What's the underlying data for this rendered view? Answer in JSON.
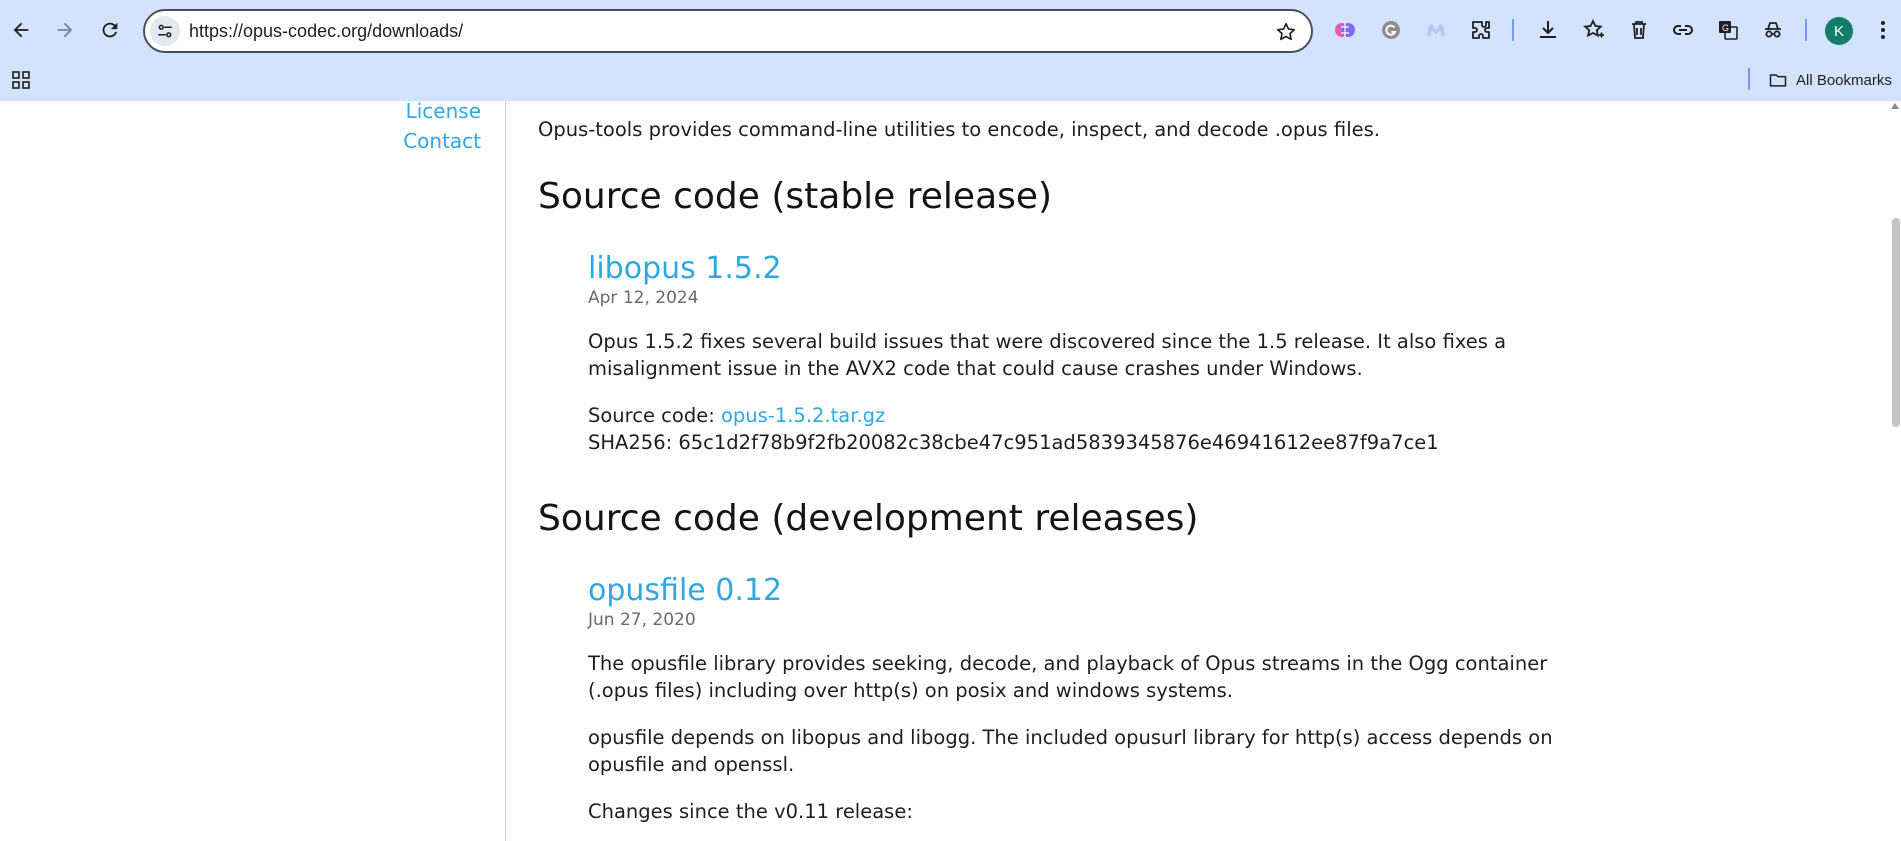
{
  "browser": {
    "url": "https://opus-codec.org/downloads/",
    "avatar_letter": "K",
    "all_bookmarks_label": "All Bookmarks",
    "icons": [
      "back-arrow-icon",
      "forward-arrow-icon",
      "reload-icon",
      "site-info-icon",
      "star-icon",
      "ai-brain-extension-icon",
      "grammarly-icon",
      "malwarebytes-icon",
      "puzzle-extensions-icon",
      "download-icon",
      "reading-list-icon",
      "trash-icon",
      "link-icon",
      "translate-icon",
      "incognito-spy-icon",
      "kebab-menu-icon",
      "apps-grid-icon",
      "folder-icon"
    ]
  },
  "sidebar": {
    "links": [
      "License",
      "Contact"
    ]
  },
  "main": {
    "intro": "Opus-tools provides command-line utilities to encode, inspect, and decode .opus files.",
    "stable_heading": "Source code (stable release)",
    "stable": {
      "title": "libopus 1.5.2",
      "date": "Apr 12, 2024",
      "description": "Opus 1.5.2 fixes several build issues that were discovered since the 1.5 release. It also fixes a misalignment issue in the AVX2 code that could cause crashes under Windows.",
      "source_label": "Source code: ",
      "source_link": "opus-1.5.2.tar.gz",
      "sha_line": "SHA256: 65c1d2f78b9f2fb20082c38cbe47c951ad5839345876e46941612ee87f9a7ce1"
    },
    "dev_heading": "Source code (development releases)",
    "dev": {
      "title": "opusfile 0.12",
      "date": "Jun 27, 2020",
      "description1": "The opusfile library provides seeking, decode, and playback of Opus streams in the Ogg container (.opus files) including over http(s) on posix and windows systems.",
      "description2": "opusfile depends on libopus and libogg. The included opusurl library for http(s) access depends on opusfile and openssl.",
      "changes": "Changes since the v0.11 release:"
    }
  },
  "colors": {
    "chrome_bg": "#d3e3fd",
    "link": "#2fa8e0",
    "avatar": "#117d6a"
  }
}
